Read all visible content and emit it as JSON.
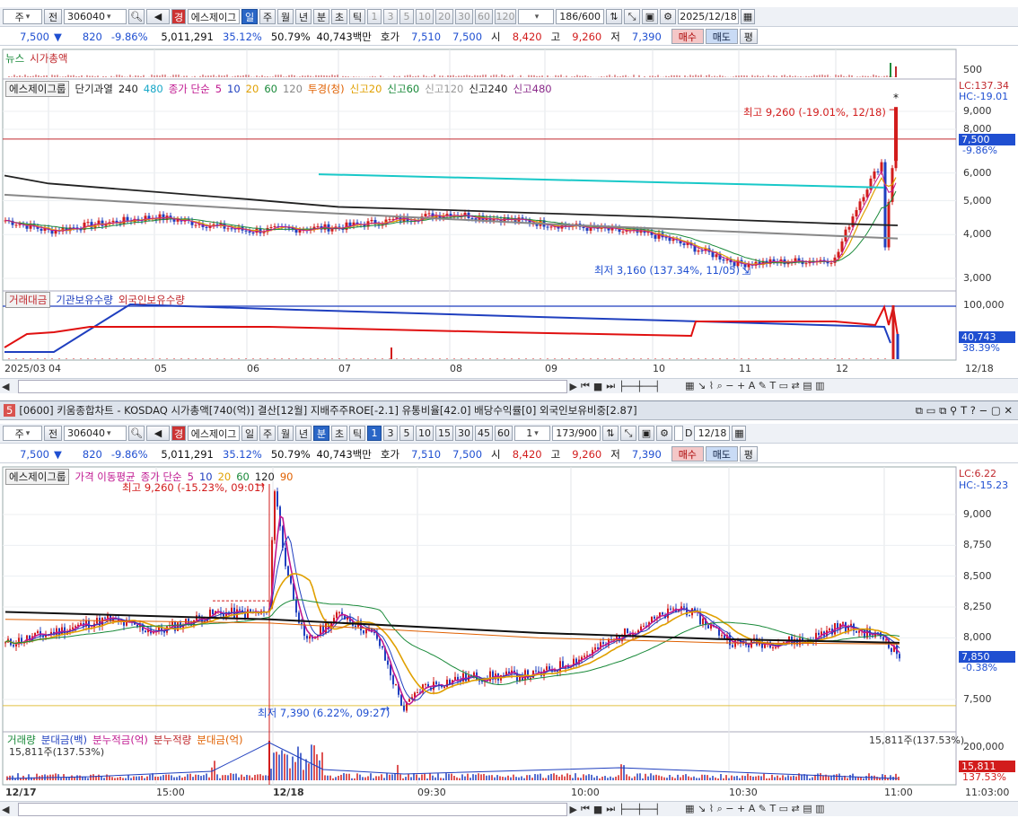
{
  "top": {
    "toolbar": {
      "market": "주",
      "all": "전",
      "code": "306040",
      "sector": "경",
      "name": "에스제이그",
      "periods": [
        "일",
        "주",
        "월",
        "년",
        "분",
        "초",
        "틱"
      ],
      "period_selected": "일",
      "minutes": [
        "1",
        "3",
        "5",
        "10",
        "20",
        "30",
        "60",
        "120"
      ],
      "count": "186/600",
      "date": "2025/12/18"
    },
    "quote": {
      "price": "7,500",
      "arrow": "▼",
      "change": "820",
      "rate": "-9.86%",
      "volume": "5,011,291",
      "turnover_rate": "35.12%",
      "ratio": "50.79%",
      "amount": "40,743백만",
      "hoga_label": "호가",
      "ask": "7,510",
      "bid": "7,500",
      "open_label": "시",
      "open": "8,420",
      "high_label": "고",
      "high": "9,260",
      "low_label": "저",
      "low": "7,390",
      "buy": "매수",
      "sell": "매도",
      "eval": "평"
    },
    "news_legend": [
      "뉴스",
      "시가총액"
    ],
    "news_axis": "500",
    "price_legend": {
      "name": "에스제이그룹",
      "items": [
        {
          "label": "단기과열",
          "color": "#222"
        },
        {
          "label": "240",
          "color": "#222"
        },
        {
          "label": "480",
          "color": "#18a8c8"
        },
        {
          "label": "종가 단순",
          "color": "#c01890"
        },
        {
          "label": "5",
          "color": "#c01890"
        },
        {
          "label": "10",
          "color": "#1f3fbf"
        },
        {
          "label": "20",
          "color": "#e0a000"
        },
        {
          "label": "60",
          "color": "#1a8a3a"
        },
        {
          "label": "120",
          "color": "#888"
        },
        {
          "label": "투경(청)",
          "color": "#e06000"
        },
        {
          "label": "신고20",
          "color": "#e0a000"
        },
        {
          "label": "신고60",
          "color": "#1a8a3a"
        },
        {
          "label": "신고120",
          "color": "#999"
        },
        {
          "label": "신고240",
          "color": "#222"
        },
        {
          "label": "신고480",
          "color": "#8a2a8a"
        }
      ]
    },
    "price_axis": [
      "9,000",
      "8,000",
      "6,000",
      "5,000",
      "4,000",
      "3,000"
    ],
    "price_axis_values": [
      9000,
      8000,
      6000,
      5000,
      4000,
      3000
    ],
    "lc": "LC:137.34",
    "hc": "HC:-19.01",
    "price_tag": "7,500",
    "price_tag_rate": "-9.86%",
    "high_note": "최고 9,260 (-19.01%, 12/18)",
    "low_note": "최저 3,160 (137.34%, 11/05)",
    "vol_legend": [
      "거래대금",
      "기관보유수량",
      "외국인보유수량"
    ],
    "vol_axis": "100,000",
    "vol_tag": "40,743",
    "vol_tag_rate": "38.39%",
    "x_labels": [
      "2025/03",
      "04",
      "05",
      "06",
      "07",
      "08",
      "09",
      "10",
      "11",
      "12"
    ],
    "x_end": "12/18",
    "chart_data": {
      "type": "line",
      "title": "",
      "ylim": [
        2900,
        9500
      ],
      "log_scale": true,
      "x": [
        "2025/03",
        "04",
        "05",
        "06",
        "07",
        "08",
        "09",
        "10",
        "11",
        "12",
        "12/18"
      ],
      "series": [
        {
          "name": "종가",
          "values": [
            4400,
            4100,
            4500,
            4100,
            4200,
            4600,
            4300,
            4000,
            3300,
            3400,
            7500
          ]
        },
        {
          "name": "240",
          "values": [
            5900,
            5600,
            5300,
            5050,
            4800,
            4700,
            4600,
            4500,
            4400,
            4300,
            4250
          ]
        },
        {
          "name": "480",
          "values": [
            null,
            null,
            null,
            null,
            null,
            5450,
            5300,
            5150,
            5000,
            4850,
            4750
          ]
        }
      ],
      "high": {
        "value": 9260,
        "date": "12/18",
        "rate": "-19.01%"
      },
      "low": {
        "value": 3160,
        "date": "11/05",
        "rate": "137.34%"
      }
    }
  },
  "bottom": {
    "title": "[0600] 키움종합차트 - KOSDAQ 시가총액[740(억)] 결산[12월] 지배주주ROE[-2.1] 유통비율[42.0] 배당수익률[0] 외국인보유비중[2.87]",
    "window_no": "5",
    "toolbar": {
      "market": "주",
      "all": "전",
      "code": "306040",
      "sector": "경",
      "name": "에스제이그",
      "periods": [
        "일",
        "주",
        "월",
        "년",
        "분",
        "초",
        "틱"
      ],
      "period_selected": "분",
      "minutes": [
        "1",
        "3",
        "5",
        "10",
        "15",
        "30",
        "45",
        "60"
      ],
      "minute_selected": "1",
      "unit": "1",
      "count": "173/900",
      "d_label": "D",
      "date": "12/18"
    },
    "quote": {
      "price": "7,500",
      "arrow": "▼",
      "change": "820",
      "rate": "-9.86%",
      "volume": "5,011,291",
      "turnover_rate": "35.12%",
      "ratio": "50.79%",
      "amount": "40,743백만",
      "hoga_label": "호가",
      "ask": "7,510",
      "bid": "7,500",
      "open_label": "시",
      "open": "8,420",
      "high_label": "고",
      "high": "9,260",
      "low_label": "저",
      "low": "7,390",
      "buy": "매수",
      "sell": "매도",
      "eval": "평"
    },
    "price_legend": {
      "name": "에스제이그룹",
      "items": [
        {
          "label": "가격 이동평균",
          "color": "#c01890"
        },
        {
          "label": "종가 단순",
          "color": "#c01890"
        },
        {
          "label": "5",
          "color": "#c01890"
        },
        {
          "label": "10",
          "color": "#1f3fbf"
        },
        {
          "label": "20",
          "color": "#e0a000"
        },
        {
          "label": "60",
          "color": "#1a8a3a"
        },
        {
          "label": "120",
          "color": "#222"
        },
        {
          "label": "90",
          "color": "#e06000"
        }
      ]
    },
    "price_axis": [
      "9,000",
      "8,750",
      "8,500",
      "8,250",
      "8,000",
      "7,500"
    ],
    "price_axis_values": [
      9000,
      8750,
      8500,
      8250,
      8000,
      7500
    ],
    "lc": "LC:6.22",
    "hc": "HC:-15.23",
    "price_tag": "7,850",
    "price_tag_rate": "-0.38%",
    "high_note": "최고 9,260 (-15.23%, 09:01)",
    "low_note": "최저 7,390 (6.22%, 09:27)",
    "vol_legend": [
      "거래량",
      "분대금(백)",
      "분누적금(억)",
      "분누적량",
      "분대금(억)"
    ],
    "vol_note_left": "15,811주(137.53%)",
    "vol_note_right": "15,811주(137.53%)",
    "vol_axis": "200,000",
    "vol_tag": "15,811",
    "vol_tag_rate": "137.53%",
    "x_labels": [
      "12/17",
      "15:00",
      "12/18",
      "09:30",
      "10:00",
      "10:30",
      "11:00"
    ],
    "x_end": "11:03:00",
    "chart_data": {
      "type": "line",
      "title": "",
      "ylim": [
        7390,
        9300
      ],
      "x": [
        "12/17",
        "15:00",
        "12/18 09:00",
        "09:30",
        "10:00",
        "10:30",
        "11:00"
      ],
      "series": [
        {
          "name": "종가",
          "values": [
            7950,
            8100,
            8700,
            7600,
            7700,
            8000,
            7850
          ]
        },
        {
          "name": "120",
          "values": [
            8200,
            8150,
            8150,
            8050,
            7980,
            7980,
            7960
          ]
        }
      ],
      "high": {
        "value": 9260,
        "time": "09:01",
        "rate": "-15.23%"
      },
      "low": {
        "value": 7390,
        "time": "09:27",
        "rate": "6.22%"
      }
    }
  }
}
